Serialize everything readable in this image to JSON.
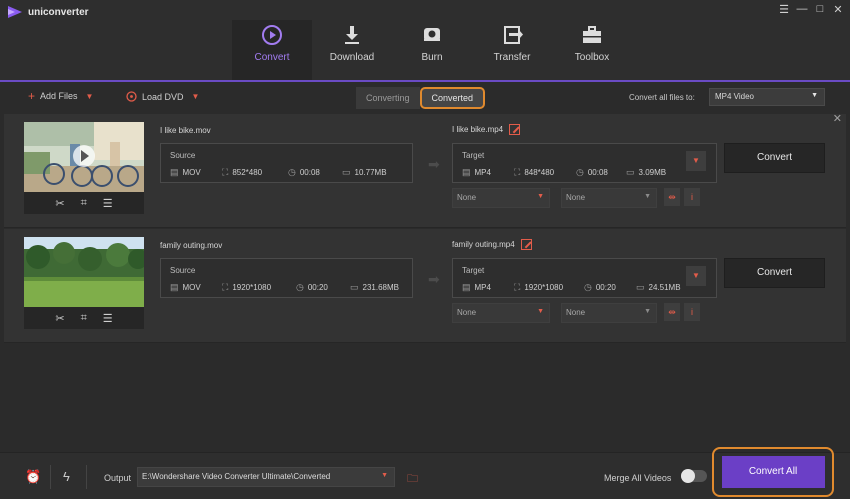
{
  "app": {
    "title": "uniconverter"
  },
  "window_controls": [
    "☰",
    "—",
    "□",
    "✕"
  ],
  "nav": [
    {
      "label": "Convert",
      "icon": "convert-icon",
      "active": true
    },
    {
      "label": "Download",
      "icon": "download-icon",
      "active": false
    },
    {
      "label": "Burn",
      "icon": "burn-icon",
      "active": false
    },
    {
      "label": "Transfer",
      "icon": "transfer-icon",
      "active": false
    },
    {
      "label": "Toolbox",
      "icon": "toolbox-icon",
      "active": false
    }
  ],
  "toolbar": {
    "add_files": "Add Files",
    "load_dvd": "Load DVD",
    "tab_converting": "Converting",
    "tab_converted": "Converted",
    "convert_all_label": "Convert all files to:",
    "convert_all_value": "MP4 Video"
  },
  "items": [
    {
      "source_name": "I like bike.mov",
      "source": {
        "label": "Source",
        "format": "MOV",
        "resolution": "852*480",
        "duration": "00:08",
        "size": "10.77MB"
      },
      "target_name": "I like bike.mp4",
      "target": {
        "label": "Target",
        "format": "MP4",
        "resolution": "848*480",
        "duration": "00:08",
        "size": "3.09MB"
      },
      "subtitle": "None",
      "audio": "None",
      "convert_label": "Convert"
    },
    {
      "source_name": "family outing.mov",
      "source": {
        "label": "Source",
        "format": "MOV",
        "resolution": "1920*1080",
        "duration": "00:20",
        "size": "231.68MB"
      },
      "target_name": "family outing.mp4",
      "target": {
        "label": "Target",
        "format": "MP4",
        "resolution": "1920*1080",
        "duration": "00:20",
        "size": "24.51MB"
      },
      "subtitle": "None",
      "audio": "None",
      "convert_label": "Convert"
    }
  ],
  "bottom": {
    "output_label": "Output",
    "output_path": "E:\\Wondershare Video Converter Ultimate\\Converted",
    "merge_label": "Merge All Videos",
    "merge_on": false,
    "convert_all": "Convert All"
  },
  "colors": {
    "accent": "#6b3fc6",
    "highlight": "#e08a2e",
    "icon_red": "#e25c4a",
    "nav_active": "#a27cf0"
  }
}
